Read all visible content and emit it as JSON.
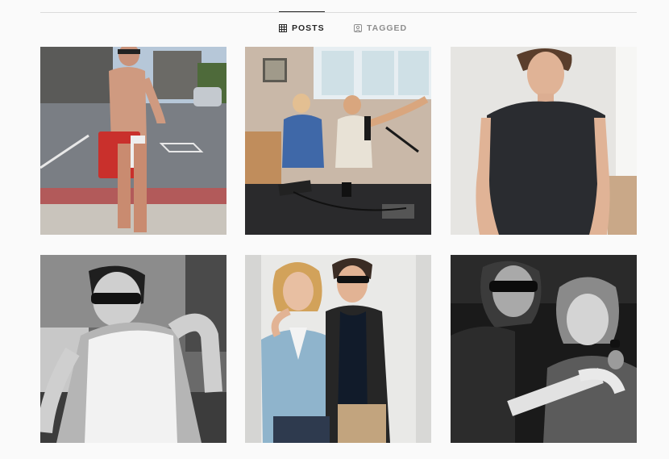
{
  "tabs": [
    {
      "label": "POSTS",
      "icon": "grid-icon",
      "active": true
    },
    {
      "label": "TAGGED",
      "icon": "tagged-icon",
      "active": false
    }
  ],
  "posts": [
    {
      "scene": "street-shirtless-red-bag"
    },
    {
      "scene": "podcast-studio-two-men"
    },
    {
      "scene": "portrait-black-tshirt"
    },
    {
      "scene": "bw-sunglasses-tank-top"
    },
    {
      "scene": "two-men-white-wall"
    },
    {
      "scene": "bw-concert-singer"
    }
  ],
  "colors": {
    "background": "#fafafa",
    "divider": "#dbdbdb",
    "tab_active": "#262626",
    "tab_inactive": "#8e8e8e"
  }
}
